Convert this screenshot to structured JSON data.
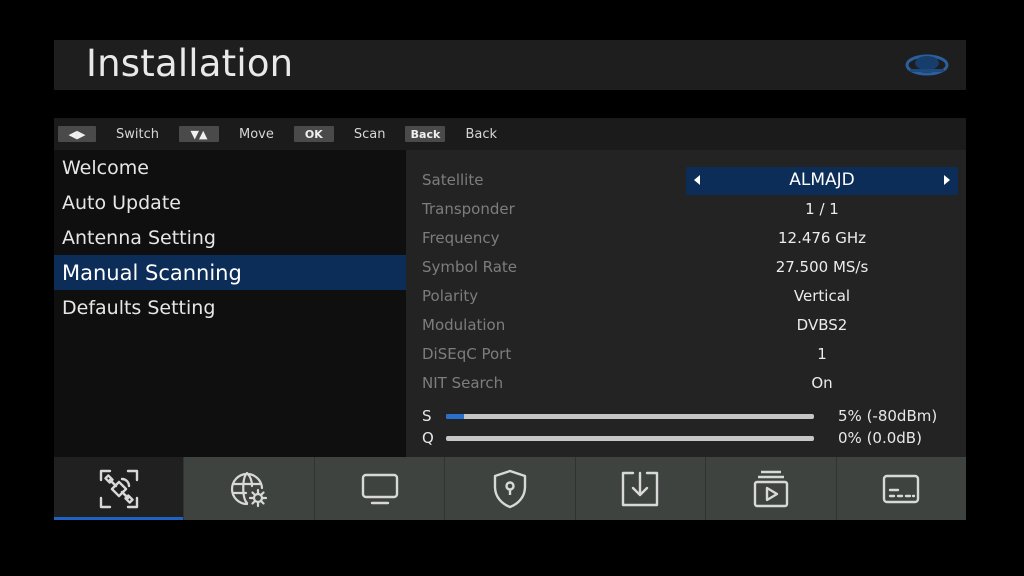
{
  "header": {
    "title": "Installation"
  },
  "hints": [
    {
      "key": "◀▶",
      "label": "Switch"
    },
    {
      "key": "▼▲",
      "label": "Move"
    },
    {
      "key": "OK",
      "label": "Scan"
    },
    {
      "key": "Back",
      "label": "Back"
    }
  ],
  "menu": [
    {
      "label": "Welcome"
    },
    {
      "label": "Auto Update"
    },
    {
      "label": "Antenna Setting"
    },
    {
      "label": "Manual Scanning"
    },
    {
      "label": "Defaults Setting"
    }
  ],
  "settings": [
    {
      "label": "Satellite",
      "value": "ALMAJD"
    },
    {
      "label": "Transponder",
      "value": "1 / 1"
    },
    {
      "label": "Frequency",
      "value": "12.476 GHz"
    },
    {
      "label": "Symbol Rate",
      "value": "27.500 MS/s"
    },
    {
      "label": "Polarity",
      "value": "Vertical"
    },
    {
      "label": "Modulation",
      "value": "DVBS2"
    },
    {
      "label": "DiSEqC Port",
      "value": "1"
    },
    {
      "label": "NIT Search",
      "value": "On"
    }
  ],
  "signal": {
    "strength": {
      "label": "S",
      "value": "5% (-80dBm)",
      "percent": 5
    },
    "quality": {
      "label": "Q",
      "value": "0% (0.0dB)",
      "percent": 0
    }
  },
  "tabs": [
    {
      "icon": "satellite-icon",
      "selected": true
    },
    {
      "icon": "network-settings-icon"
    },
    {
      "icon": "display-icon"
    },
    {
      "icon": "shield-lock-icon"
    },
    {
      "icon": "download-icon"
    },
    {
      "icon": "media-player-icon"
    },
    {
      "icon": "subtitle-icon"
    }
  ],
  "colors": {
    "accent": "#0b2d57",
    "tab_underline": "#1e63c4",
    "signal_fill": "#2a6fc9"
  }
}
